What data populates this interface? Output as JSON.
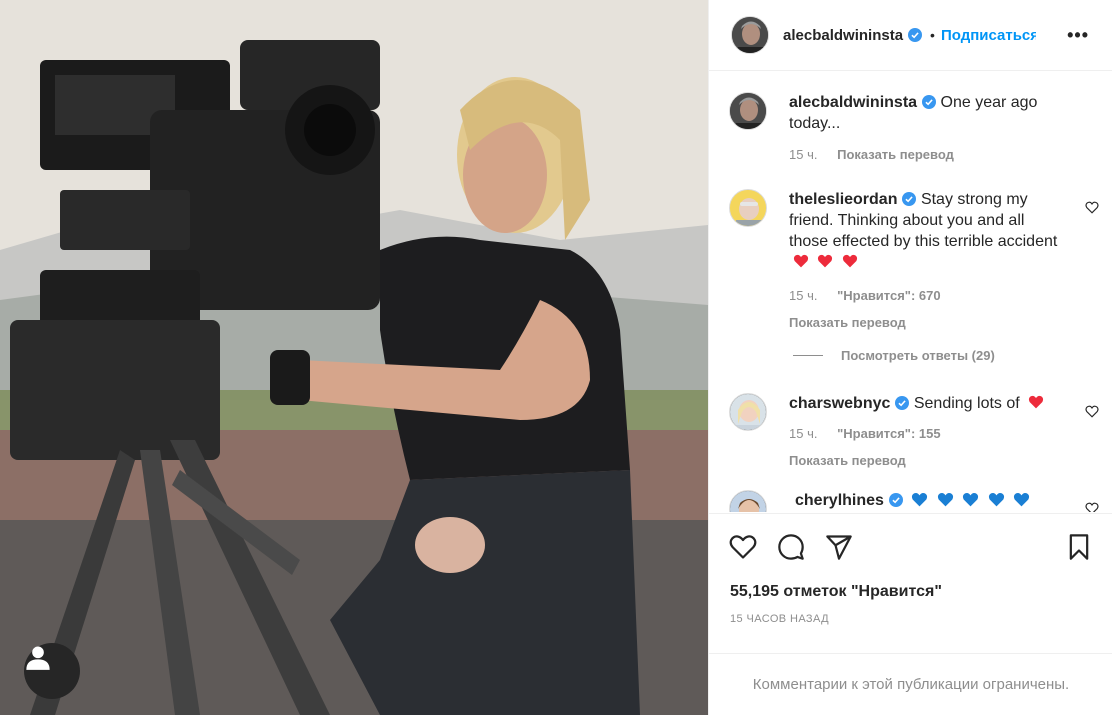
{
  "post": {
    "author": "alecbaldwininsta",
    "follow_label": "Подписаться",
    "separator": "•",
    "more_label": "•••"
  },
  "caption": {
    "author": "alecbaldwininsta",
    "text": "One year ago today...",
    "time": "15 ч.",
    "translate_label": "Показать перевод"
  },
  "comments": [
    {
      "author": "theleslieordan",
      "text": "Stay strong my friend. Thinking about you and all those effected by this terrible accident",
      "time": "15 ч.",
      "likes": "\"Нравится\": 670",
      "translate_label": "Показать перевод"
    },
    {
      "author": "charswebnyc",
      "text": "Sending lots of",
      "time": "15 ч.",
      "likes": "\"Нравится\": 155",
      "translate_label": "Показать перевод"
    },
    {
      "author": "cherylhines",
      "text": ""
    }
  ],
  "view_replies_label": "Посмотреть ответы (29)",
  "likes_count": "55,195 отметок \"Нравится\"",
  "time_ago": "15 ЧАСОВ НАЗАД",
  "comments_limited": "Комментарии к этой публикации ограничены.",
  "icons": {
    "like": "heart-icon",
    "comment": "comment-icon",
    "share": "share-icon",
    "save": "bookmark-icon",
    "verified": "verified-badge-icon"
  },
  "colors": {
    "accent_blue": "#0095f6",
    "verified_blue": "#3897f0",
    "heart_red": "#ed4956",
    "muted_text": "#8e8e8e"
  }
}
